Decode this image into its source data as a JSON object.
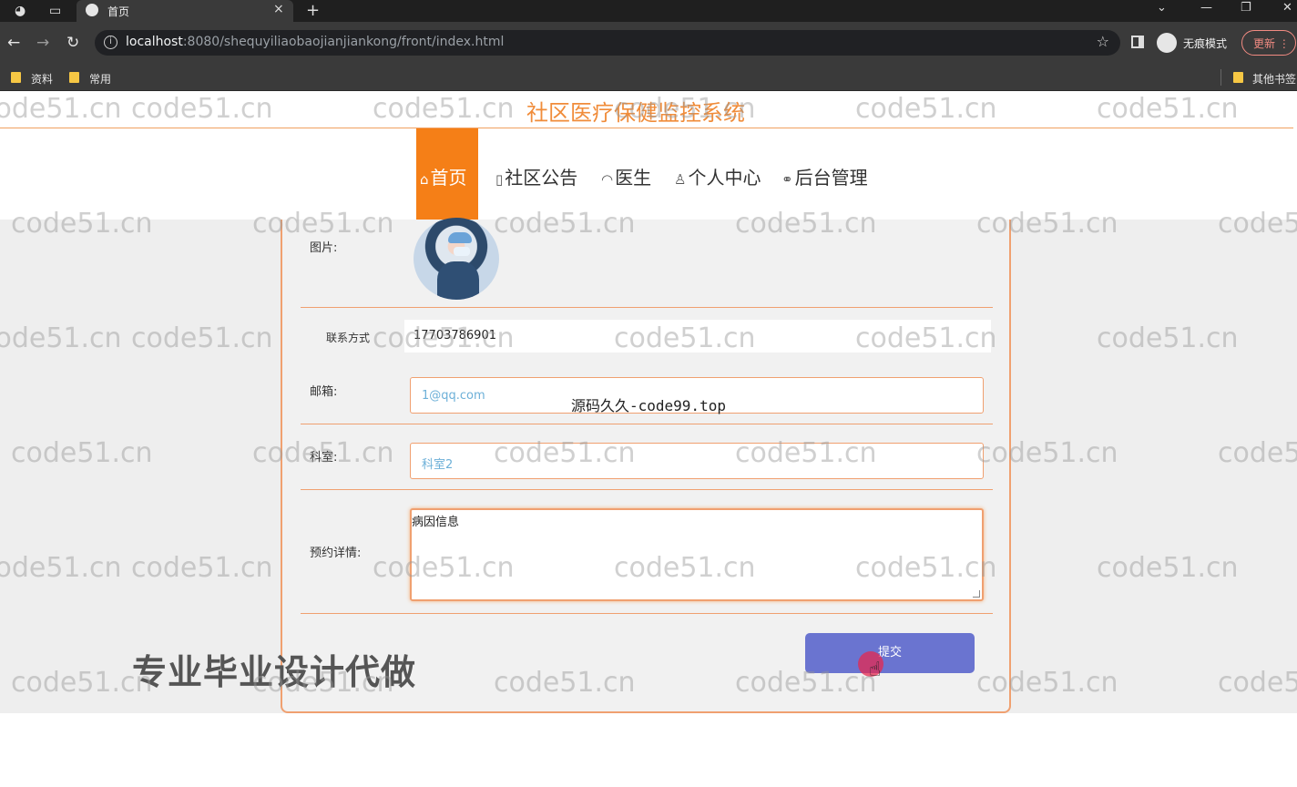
{
  "browser": {
    "tab_title": "首页",
    "tab_close": "×",
    "new_tab": "+",
    "url_host": "localhost",
    "url_rest": ":8080/shequyiliaobaojianjiankong/front/index.html",
    "incognito_label": "无痕模式",
    "update_label": "更新",
    "bookmarks": [
      "资料",
      "常用"
    ],
    "other_bookmarks": "其他书签"
  },
  "site": {
    "title": "社区医疗保健监控系统",
    "nav": [
      {
        "icon": "⌂",
        "label": "首页"
      },
      {
        "icon": "▯",
        "label": "社区公告"
      },
      {
        "icon": "◠",
        "label": "医生"
      },
      {
        "icon": "♙",
        "label": "个人中心"
      },
      {
        "icon": "⚭",
        "label": "后台管理"
      }
    ]
  },
  "form": {
    "image_label": "图片:",
    "contact_label": "联系方式",
    "contact_value": "17703786901",
    "email_label": "邮箱:",
    "email_placeholder": "1@qq.com",
    "department_label": "科室:",
    "department_placeholder": "科室2",
    "detail_label": "预约详情:",
    "detail_value": "病因信息",
    "submit_label": "提交"
  },
  "overlays": {
    "code_watermark": "源码久久-code99.top",
    "ad_text": "专业毕业设计代做",
    "watermark": "code51.cn"
  },
  "colors": {
    "accent": "#f57f17",
    "title": "#f08c3a",
    "button": "#6a74d0",
    "placeholder": "#6db0d8"
  }
}
